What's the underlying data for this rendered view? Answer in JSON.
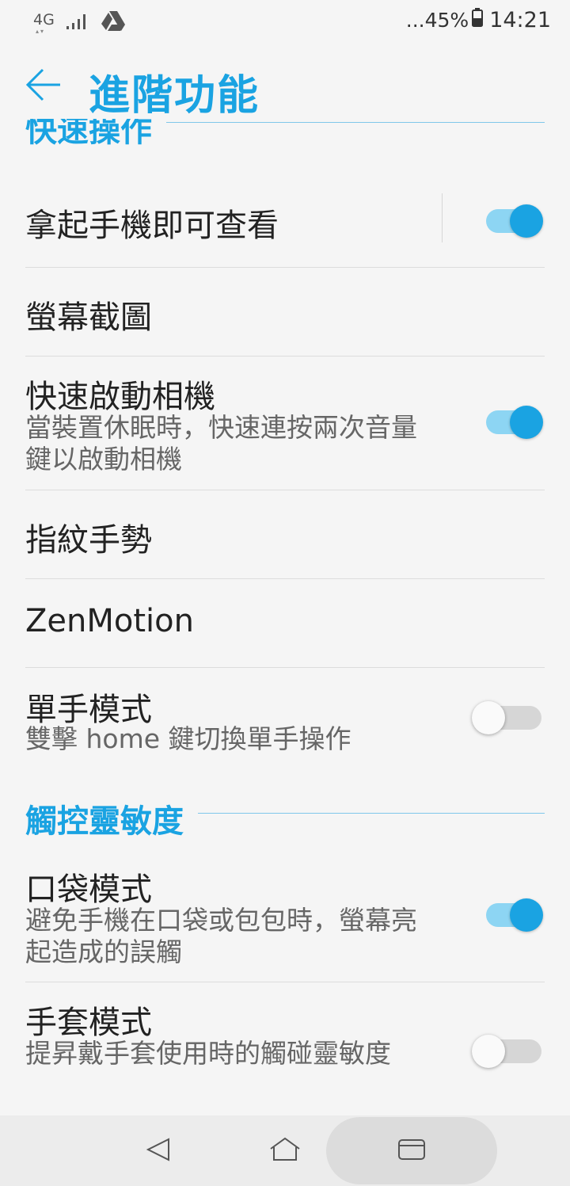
{
  "status_bar": {
    "network": "4G",
    "battery_text": "...45%",
    "time": "14:21"
  },
  "header": {
    "title": "進階功能"
  },
  "sections": {
    "quick_ops": {
      "label": "快速操作",
      "items": [
        {
          "title": "拿起手機即可查看",
          "subtitle": "",
          "toggle": "on"
        },
        {
          "title": "螢幕截圖",
          "subtitle": ""
        },
        {
          "title": "快速啟動相機",
          "subtitle": "當裝置休眠時，快速連按兩次音量鍵以啟動相機",
          "toggle": "on"
        },
        {
          "title": "指紋手勢",
          "subtitle": ""
        },
        {
          "title": "ZenMotion",
          "subtitle": ""
        },
        {
          "title": "單手模式",
          "subtitle": "雙擊 home 鍵切換單手操作",
          "toggle": "off"
        }
      ]
    },
    "touch": {
      "label": "觸控靈敏度",
      "items": [
        {
          "title": "口袋模式",
          "subtitle": "避免手機在口袋或包包時，螢幕亮起造成的誤觸",
          "toggle": "on"
        },
        {
          "title": "手套模式",
          "subtitle": "提昇戴手套使用時的觸碰靈敏度",
          "toggle": "off"
        }
      ]
    }
  },
  "icons": {
    "back": "arrow-left-icon",
    "signal": "signal-bars-icon",
    "drive": "google-drive-icon",
    "battery": "battery-icon",
    "nav_back": "triangle-back-icon",
    "nav_home": "home-icon",
    "nav_recent": "recent-apps-icon"
  },
  "colors": {
    "accent": "#1aa3e2",
    "toggle_track_on": "#8dd5f3",
    "toggle_track_off": "#d6d6d6"
  }
}
